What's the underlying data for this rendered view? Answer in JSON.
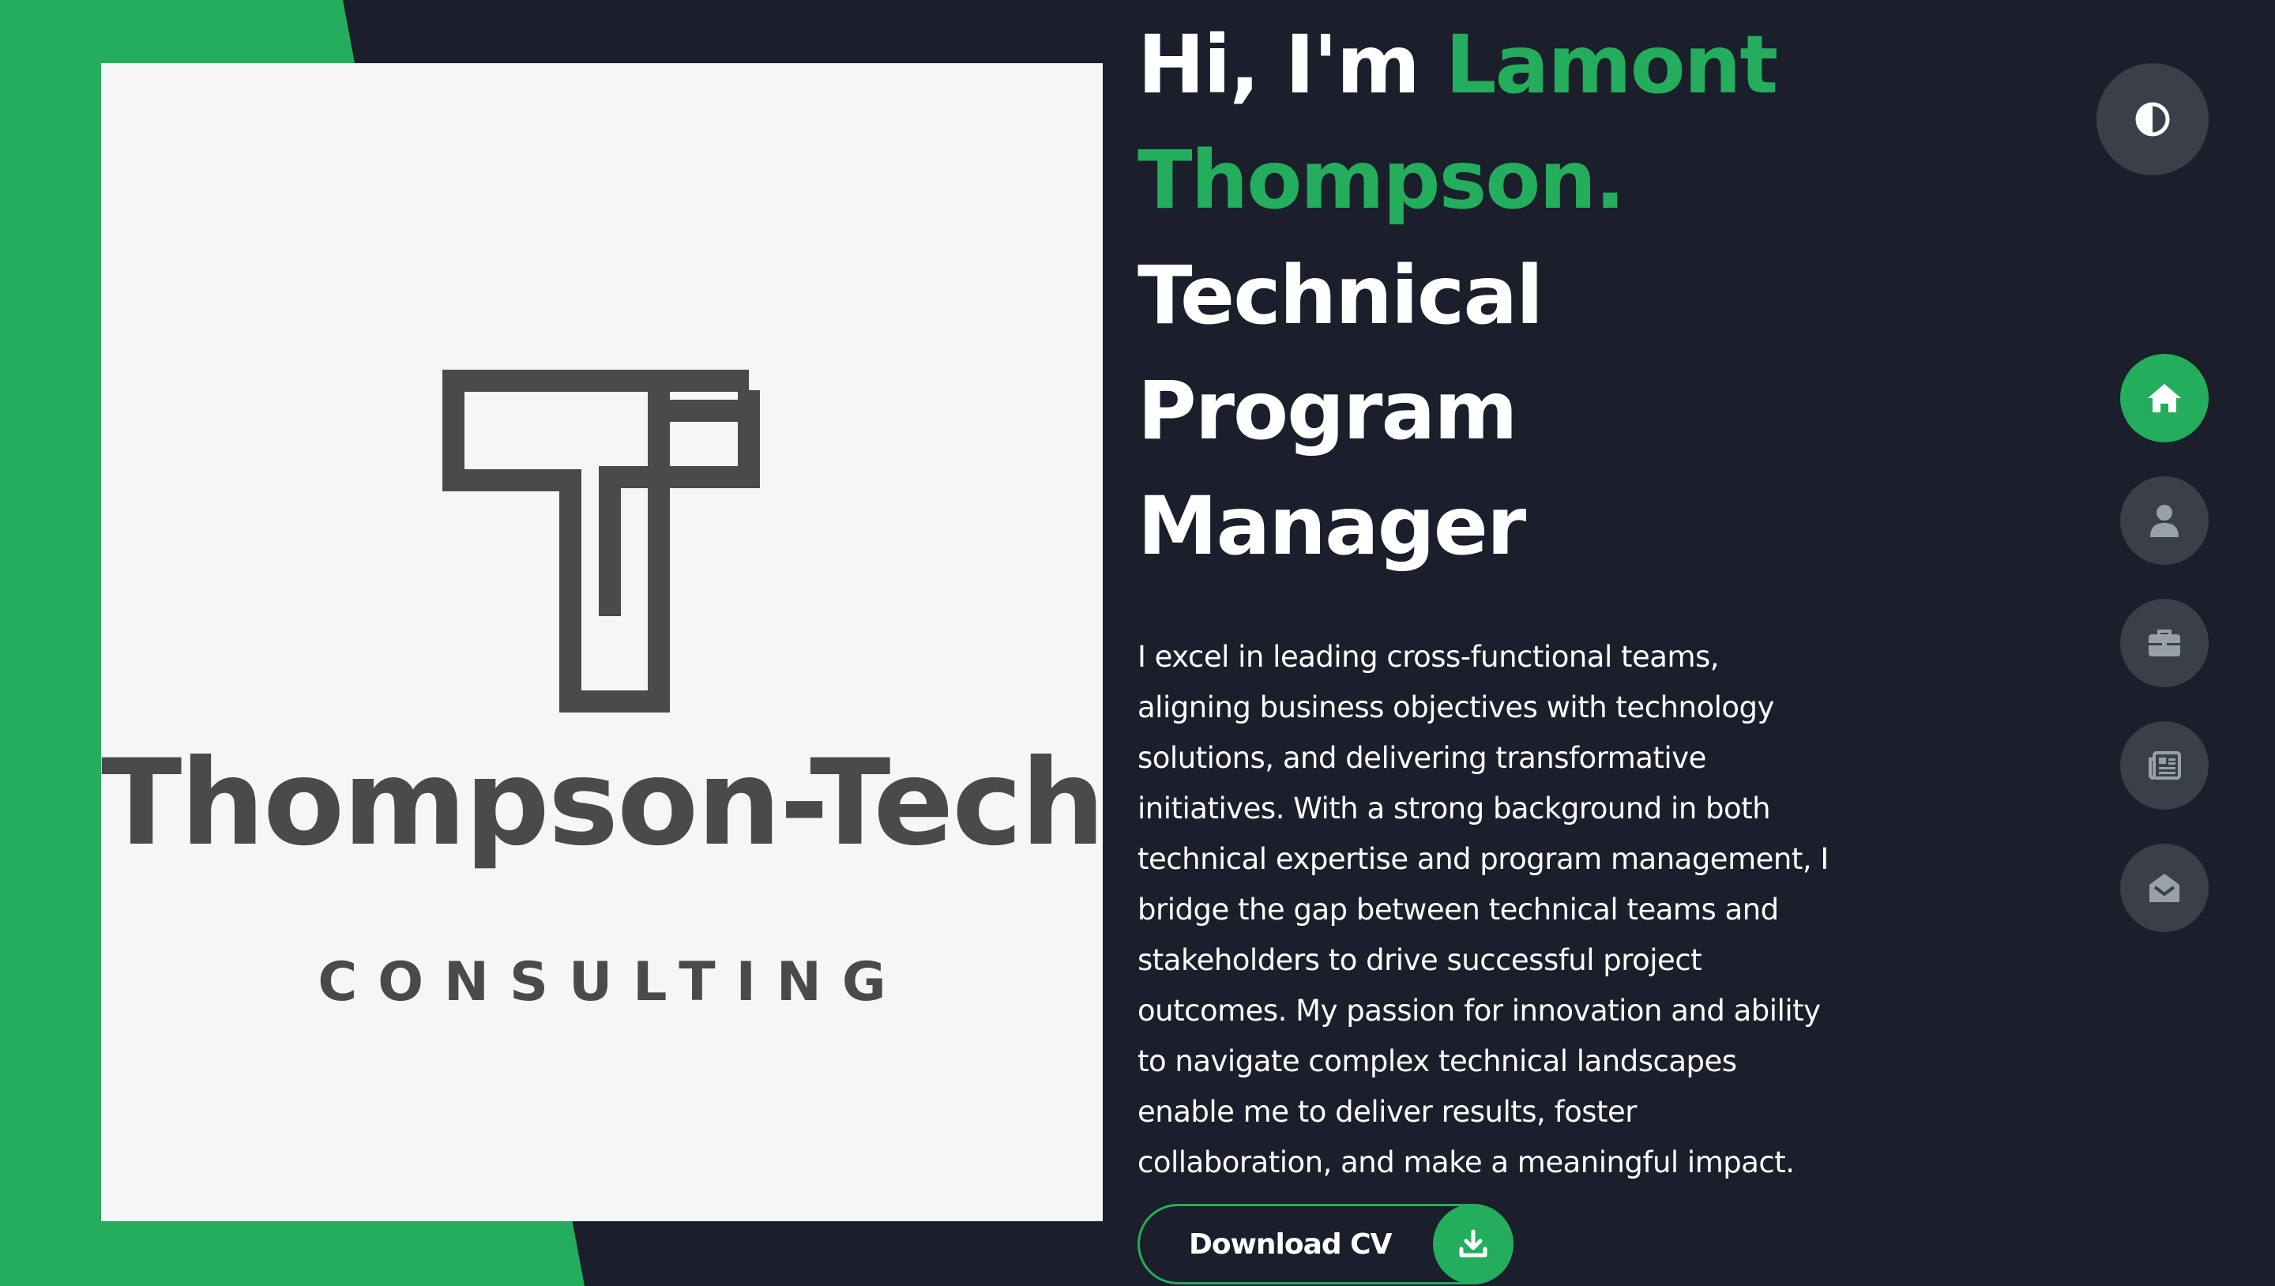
{
  "colors": {
    "background": "#1b1e2b",
    "accent": "#23ad5c",
    "card": "#f6f6f6",
    "logo": "#4a4a4a",
    "nav_button": "#3a3f4a"
  },
  "profile_logo": {
    "name": "Thompson-Tech",
    "tagline": "CONSULTING"
  },
  "hero": {
    "greeting": "Hi, I'm ",
    "name_line1": "Lamont",
    "name_line2": "Thompson.",
    "role_line1": "Technical",
    "role_line2": "Program",
    "role_line3": "Manager",
    "bio": "I excel in leading cross-functional teams, aligning business objectives with technology solutions, and delivering transformative initiatives. With a strong background in both technical expertise and program management, I bridge the gap between technical teams and stakeholders to drive successful project outcomes. My passion for innovation and ability to navigate complex technical landscapes enable me to deliver results, foster collaboration, and make a meaningful impact."
  },
  "download": {
    "label": "Download CV",
    "icon": "download-icon"
  },
  "theme_toggle": {
    "icon": "contrast-icon"
  },
  "nav": {
    "items": [
      {
        "icon": "home-icon",
        "active": true
      },
      {
        "icon": "user-icon",
        "active": false
      },
      {
        "icon": "briefcase-icon",
        "active": false
      },
      {
        "icon": "newspaper-icon",
        "active": false
      },
      {
        "icon": "envelope-open-icon",
        "active": false
      }
    ]
  }
}
